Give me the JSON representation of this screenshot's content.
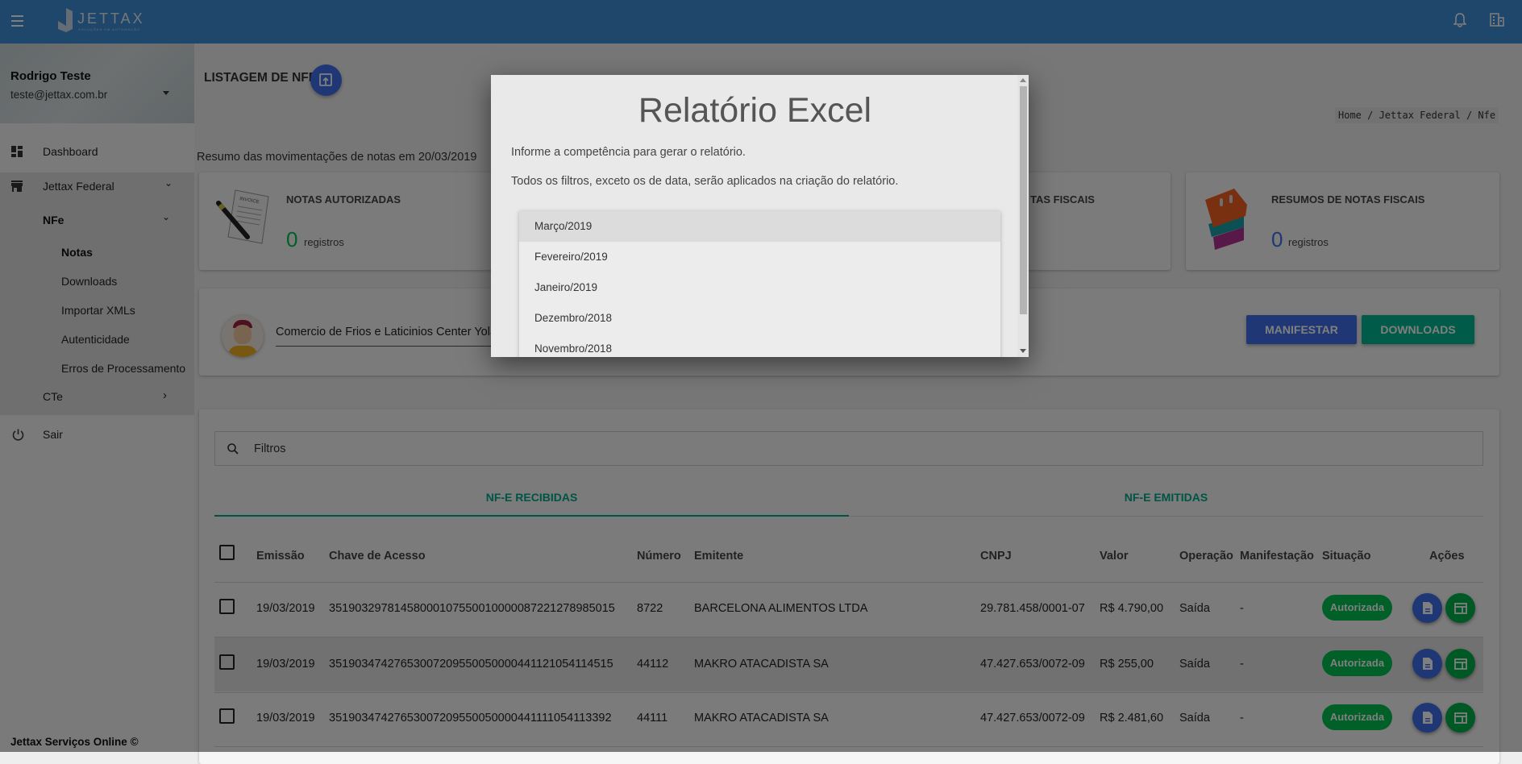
{
  "topbar": {
    "brand": "JETTAX",
    "brand_tagline": "SOLUÇÕES EM AUTOMAÇÃO",
    "icons": [
      "menu-icon",
      "bell-icon",
      "building-icon"
    ]
  },
  "sidebar": {
    "user_name": "Rodrigo Teste",
    "user_email": "teste@jettax.com.br",
    "items": [
      {
        "label": "Dashboard",
        "icon": "dashboard-icon"
      },
      {
        "label": "Jettax Federal",
        "icon": "store-icon"
      },
      {
        "label": "NFe"
      },
      {
        "label": "Notas"
      },
      {
        "label": "Downloads"
      },
      {
        "label": "Importar XMLs"
      },
      {
        "label": "Autenticidade"
      },
      {
        "label": "Erros de Processamento"
      },
      {
        "label": "CTe"
      },
      {
        "label": "Sair",
        "icon": "power-icon"
      }
    ],
    "footer": "Jettax Serviços Online ©"
  },
  "page": {
    "title": "LISTAGEM DE NFES",
    "breadcrumb": "Home / Jettax Federal / Nfe",
    "summary": "Resumo das movimentações de notas em 20/03/2019"
  },
  "cards": [
    {
      "title": "NOTAS AUTORIZADAS",
      "count": "0",
      "unit": "registros",
      "color": "#00c050"
    },
    {
      "title": "TAS FISCAIS"
    },
    {
      "title": "RESUMOS DE NOTAS FISCAIS",
      "count": "0",
      "unit": "registros",
      "color": "#3f6fe8"
    }
  ],
  "company": {
    "name": "Comercio de Frios e Laticinios Center Yolanda",
    "manifestar": "MANIFESTAR",
    "downloads": "DOWNLOADS"
  },
  "filter": {
    "placeholder": "Filtros"
  },
  "tabs": [
    {
      "label": "NF-E RECIBIDAS",
      "active": true
    },
    {
      "label": "NF-E EMITIDAS",
      "active": false
    }
  ],
  "table": {
    "headers": [
      "Emissão",
      "Chave de Acesso",
      "Número",
      "Emitente",
      "CNPJ",
      "Valor",
      "Operação",
      "Manifestação",
      "Situação",
      "Ações"
    ],
    "rows": [
      [
        "19/03/2019",
        "35190329781458000107550010000087221278985015",
        "8722",
        "BARCELONA ALIMENTOS LTDA",
        "29.781.458/0001-07",
        "R$ 4.790,00",
        "Saída",
        "-",
        "Autorizada"
      ],
      [
        "19/03/2019",
        "35190347427653007209550050000441121054114515",
        "44112",
        "MAKRO ATACADISTA SA",
        "47.427.653/0072-09",
        "R$ 255,00",
        "Saída",
        "-",
        "Autorizada"
      ],
      [
        "19/03/2019",
        "35190347427653007209550050000441111054113392",
        "44111",
        "MAKRO ATACADISTA SA",
        "47.427.653/0072-09",
        "R$ 2.481,60",
        "Saída",
        "-",
        "Autorizada"
      ]
    ]
  },
  "modal": {
    "title": "Relatório Excel",
    "line1": "Informe a competência para gerar o relatório.",
    "line2": "Todos os filtros, exceto os de data, serão aplicados na criação do relatório.",
    "options": [
      "Março/2019",
      "Fevereiro/2019",
      "Janeiro/2019",
      "Dezembro/2018",
      "Novembro/2018"
    ],
    "highlighted": "Março/2019"
  }
}
